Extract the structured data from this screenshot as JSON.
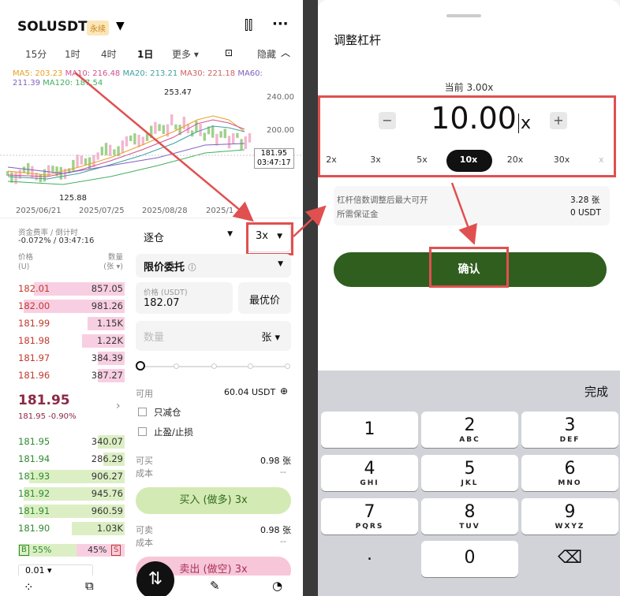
{
  "left": {
    "symbol": "SOLUSDT",
    "badge": "永续",
    "timeframes": [
      "15分",
      "1时",
      "4时",
      "1日",
      "更多 ▾"
    ],
    "hide": "隐藏",
    "ma_line1": [
      {
        "t": "MA5: 203.23",
        "c": "#e8a020"
      },
      {
        "t": "MA10: 216.48",
        "c": "#d05090"
      },
      {
        "t": "MA20: 213.21",
        "c": "#40a0a0"
      },
      {
        "t": "MA30: 221.18",
        "c": "#d06060"
      },
      {
        "t": "MA60:",
        "c": "#8060c0"
      }
    ],
    "ma_line2": [
      {
        "t": "211.39",
        "c": "#8060c0"
      },
      {
        "t": "MA120: 187.54",
        "c": "#40b060"
      }
    ],
    "chart": {
      "high": "253.47",
      "low": "125.88",
      "y1": "240.00",
      "y2": "200.00",
      "last": "181.95",
      "timer": "03:47:17",
      "dates": [
        "2025/06/21",
        "2025/07/25",
        "2025/08/28",
        "2025/1"
      ]
    },
    "funding_label": "资金费率 / 倒计时",
    "funding_value": "-0.072% / 03:47:16",
    "col_price": "价格",
    "col_price_unit": "(U)",
    "col_qty": "数量",
    "col_qty_unit": "(张 ▾)",
    "asks": [
      {
        "p": "182.01",
        "q": "857.05",
        "w": 0.85
      },
      {
        "p": "182.00",
        "q": "981.26",
        "w": 0.95
      },
      {
        "p": "181.99",
        "q": "1.15K",
        "w": 0.35
      },
      {
        "p": "181.98",
        "q": "1.22K",
        "w": 0.4
      },
      {
        "p": "181.97",
        "q": "384.39",
        "w": 0.25
      },
      {
        "p": "181.96",
        "q": "387.27",
        "w": 0.25
      }
    ],
    "last_price": "181.95",
    "last_sub": "181.95  -0.90%",
    "bids": [
      {
        "p": "181.95",
        "q": "340.07",
        "w": 0.25
      },
      {
        "p": "181.94",
        "q": "286.29",
        "w": 0.2
      },
      {
        "p": "181.93",
        "q": "906.27",
        "w": 0.9
      },
      {
        "p": "181.92",
        "q": "945.76",
        "w": 0.95
      },
      {
        "p": "181.91",
        "q": "960.59",
        "w": 0.95
      },
      {
        "p": "181.90",
        "q": "1.03K",
        "w": 0.5
      }
    ],
    "ratio_b": "B",
    "ratio_b_val": "55%",
    "ratio_s_val": "45%",
    "ratio_s": "S",
    "depth": "0.01",
    "margin_mode": "逐仓",
    "leverage": "3x",
    "order_type": "限价委托",
    "price_label": "价格 (USDT)",
    "price_value": "182.07",
    "best_price": "最优价",
    "qty_placeholder": "数量",
    "qty_unit": "张",
    "avail_label": "可用",
    "avail_value": "60.04 USDT",
    "reduce_only": "只减仓",
    "tpsl": "止盈/止损",
    "can_buy": "可买",
    "can_buy_val": "0.98 张",
    "cost": "成本",
    "cost_val": "--",
    "buy_btn": "买入 (做多) 3x",
    "can_sell": "可卖",
    "can_sell_val": "0.98 张",
    "cost2": "成本",
    "cost2_val": "--",
    "sell_btn": "卖出 (做空) 3x"
  },
  "right": {
    "title": "调整杠杆",
    "current": "当前 3.00x",
    "value": "10.00",
    "unit": "x",
    "levels": [
      "2x",
      "3x",
      "5x",
      "10x",
      "20x",
      "30x"
    ],
    "active_level": "10x",
    "info1_label": "杠杆倍数调整后最大可开",
    "info1_val": "3.28 张",
    "info2_label": "所需保证金",
    "info2_val": "0 USDT",
    "confirm": "确认",
    "done": "完成",
    "keys": [
      {
        "d": "1",
        "l": ""
      },
      {
        "d": "2",
        "l": "ABC"
      },
      {
        "d": "3",
        "l": "DEF"
      },
      {
        "d": "4",
        "l": "GHI"
      },
      {
        "d": "5",
        "l": "JKL"
      },
      {
        "d": "6",
        "l": "MNO"
      },
      {
        "d": "7",
        "l": "PQRS"
      },
      {
        "d": "8",
        "l": "TUV"
      },
      {
        "d": "9",
        "l": "WXYZ"
      }
    ],
    "key_dot": ".",
    "key_zero": "0"
  },
  "colors": {
    "ask": "#f8cfe2",
    "bid": "#dcefc4",
    "down": "#c0392b",
    "up": "#2e8b2e",
    "confirm": "#2f5e1f",
    "highlight": "#e05050",
    "buy": "#d4eab4",
    "sell": "#f7c6d8"
  }
}
